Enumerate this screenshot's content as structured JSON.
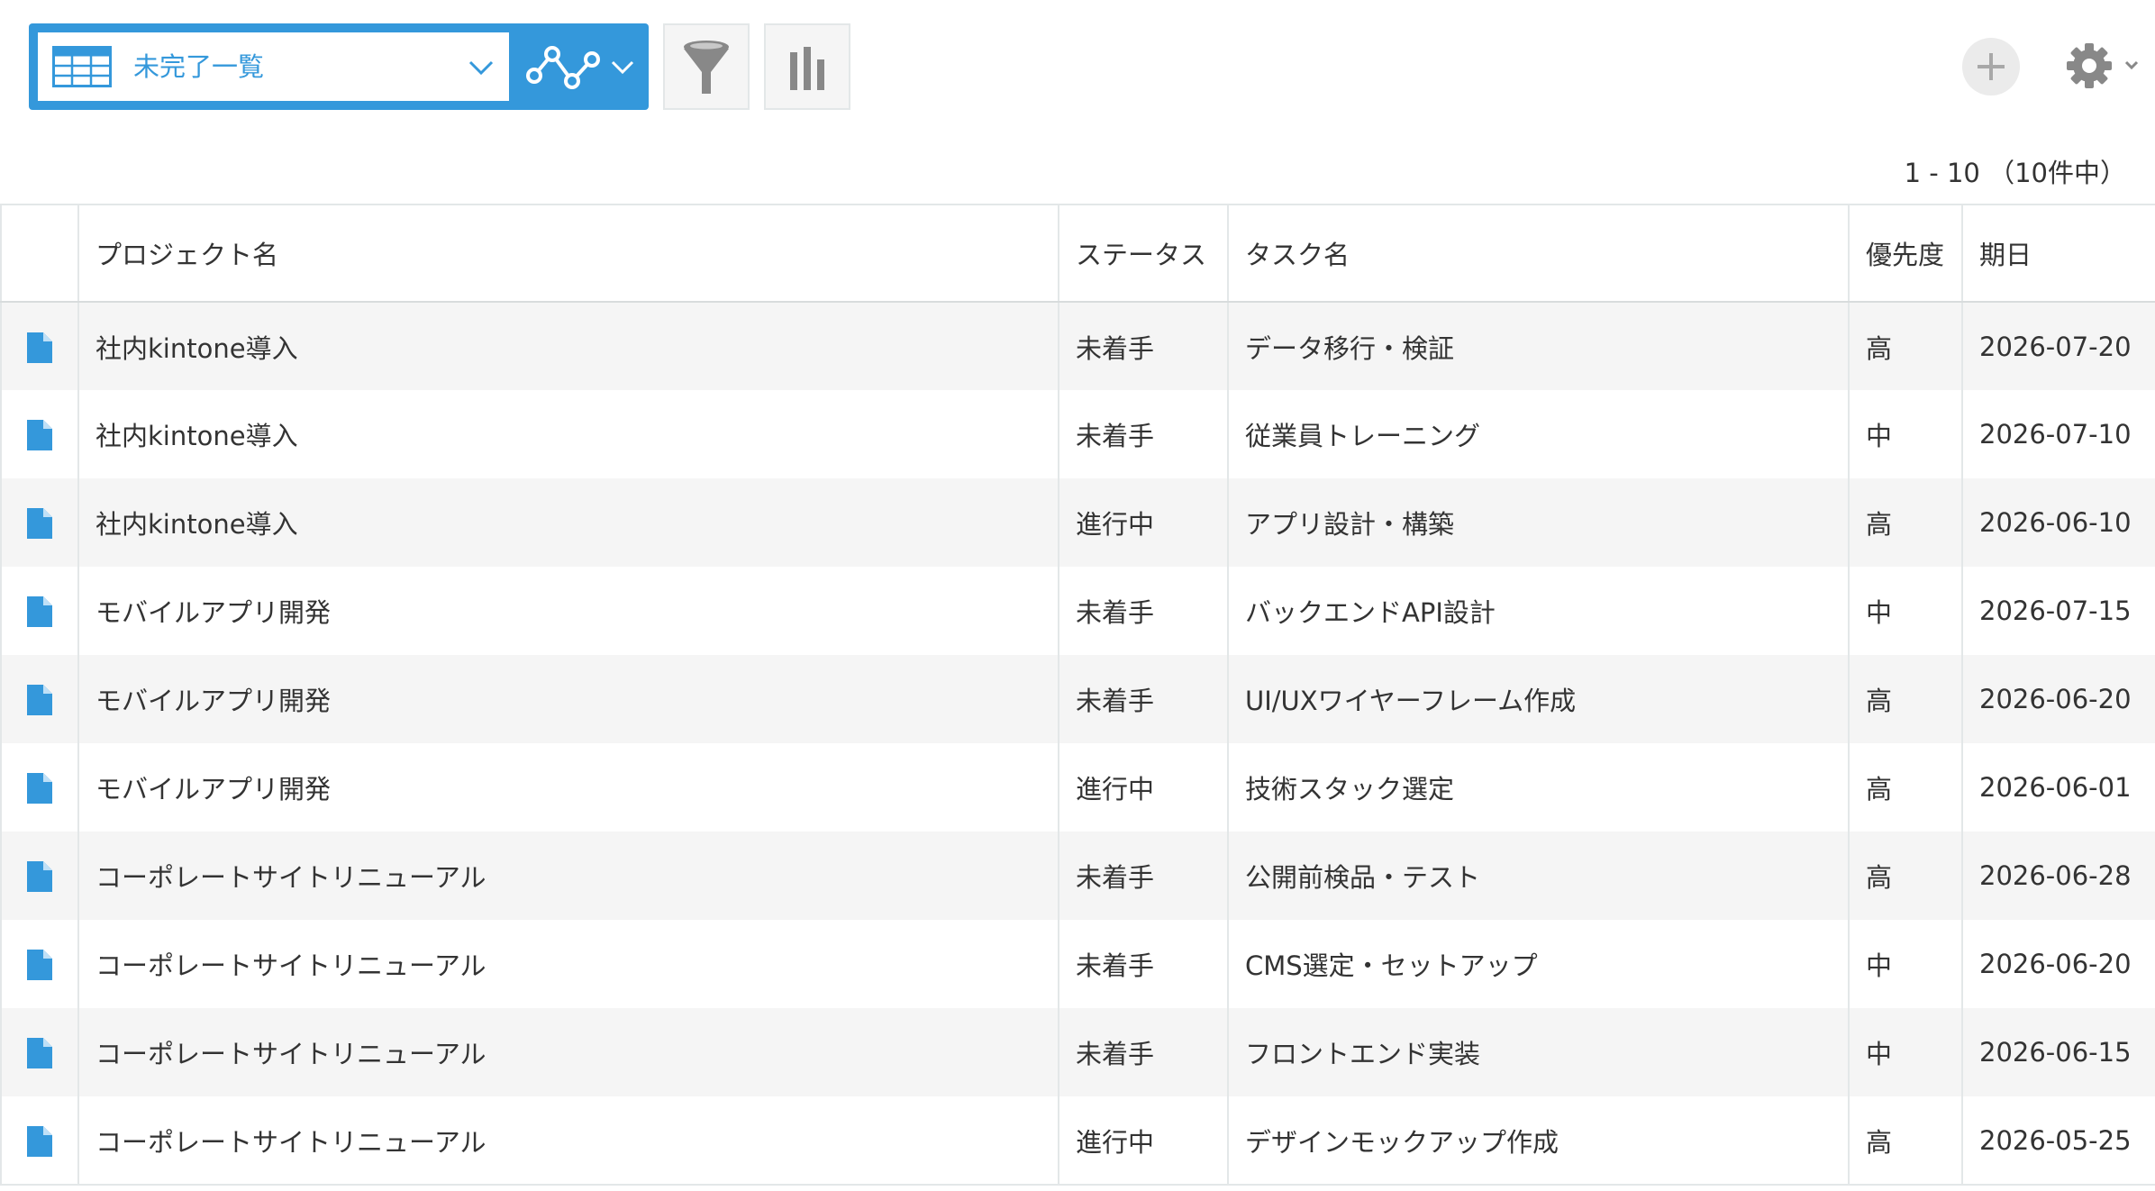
{
  "view": {
    "selected": "未完了一覧",
    "icon": "table-view-icon",
    "graph_icon": "graph-icon"
  },
  "toolbar": {
    "filter_icon": "filter-icon",
    "chart_icon": "bar-chart-icon",
    "add_icon": "plus-icon",
    "settings_icon": "gear-icon"
  },
  "pager": {
    "text": "1 - 10 （10件中）"
  },
  "table": {
    "columns": [
      "プロジェクト名",
      "ステータス",
      "タスク名",
      "優先度",
      "期日"
    ],
    "rows": [
      {
        "project": "社内kintone導入",
        "status": "未着手",
        "task": "データ移行・検証",
        "priority": "高",
        "due": "2026-07-20"
      },
      {
        "project": "社内kintone導入",
        "status": "未着手",
        "task": "従業員トレーニング",
        "priority": "中",
        "due": "2026-07-10"
      },
      {
        "project": "社内kintone導入",
        "status": "進行中",
        "task": "アプリ設計・構築",
        "priority": "高",
        "due": "2026-06-10"
      },
      {
        "project": "モバイルアプリ開発",
        "status": "未着手",
        "task": "バックエンドAPI設計",
        "priority": "中",
        "due": "2026-07-15"
      },
      {
        "project": "モバイルアプリ開発",
        "status": "未着手",
        "task": "UI/UXワイヤーフレーム作成",
        "priority": "高",
        "due": "2026-06-20"
      },
      {
        "project": "モバイルアプリ開発",
        "status": "進行中",
        "task": "技術スタック選定",
        "priority": "高",
        "due": "2026-06-01"
      },
      {
        "project": "コーポレートサイトリニューアル",
        "status": "未着手",
        "task": "公開前検品・テスト",
        "priority": "高",
        "due": "2026-06-28"
      },
      {
        "project": "コーポレートサイトリニューアル",
        "status": "未着手",
        "task": "CMS選定・セットアップ",
        "priority": "中",
        "due": "2026-06-20"
      },
      {
        "project": "コーポレートサイトリニューアル",
        "status": "未着手",
        "task": "フロントエンド実装",
        "priority": "中",
        "due": "2026-06-15"
      },
      {
        "project": "コーポレートサイトリニューアル",
        "status": "進行中",
        "task": "デザインモックアップ作成",
        "priority": "高",
        "due": "2026-05-25"
      }
    ]
  },
  "colors": {
    "accent": "#3498db",
    "row_alt": "#f5f5f5",
    "border": "#e3e7e8",
    "icon_gray": "#888888"
  }
}
